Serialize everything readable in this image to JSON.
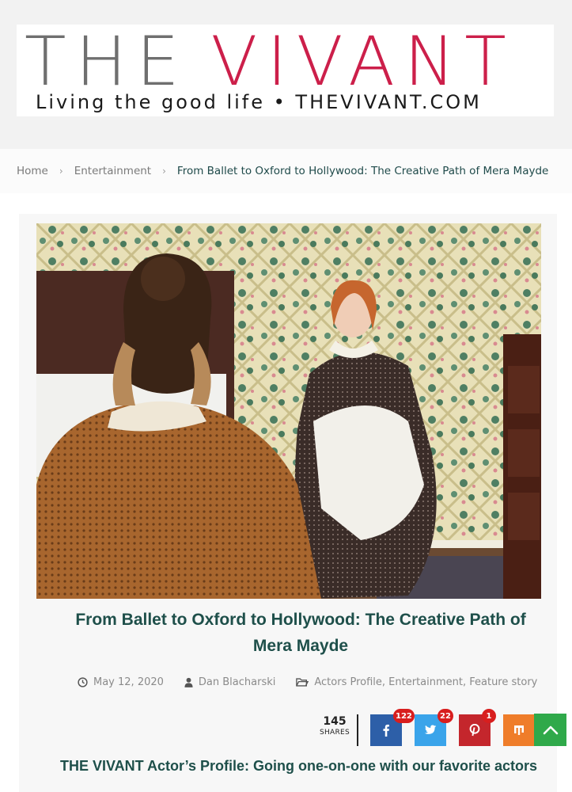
{
  "logo": {
    "the": "THE",
    "vivant": "VIVANT",
    "tagline": "Living the good life • THEVIVANT.COM"
  },
  "breadcrumb": {
    "home": "Home",
    "category": "Entertainment",
    "current": "From Ballet to Oxford to Hollywood: The Creative Path of Mera Mayde"
  },
  "article": {
    "title": "From Ballet to Oxford to Hollywood: The Creative Path of Mera Mayde",
    "date": "May 12, 2020",
    "author": "Dan Blacharski",
    "categories": "Actors Profile, Entertainment, Feature story",
    "subheading": "THE VIVANT Actor’s Profile: Going one-on-one with our favorite actors"
  },
  "share": {
    "total": "145",
    "label": "SHARES",
    "facebook_count": "122",
    "twitter_count": "22",
    "pinterest_count": "1"
  },
  "colors": {
    "brand": "#cc1f4a",
    "heading": "#1e4f4a",
    "facebook": "#2d5fa8",
    "twitter": "#3aa4ea",
    "pinterest": "#c4262c",
    "mix": "#ef7d2a",
    "to_top": "#2fa94a"
  },
  "icons": [
    "clock-icon",
    "user-icon",
    "folder-icon",
    "facebook-icon",
    "twitter-icon",
    "pinterest-icon",
    "mix-icon",
    "chevron-up-icon",
    "chevron-right-icon"
  ]
}
